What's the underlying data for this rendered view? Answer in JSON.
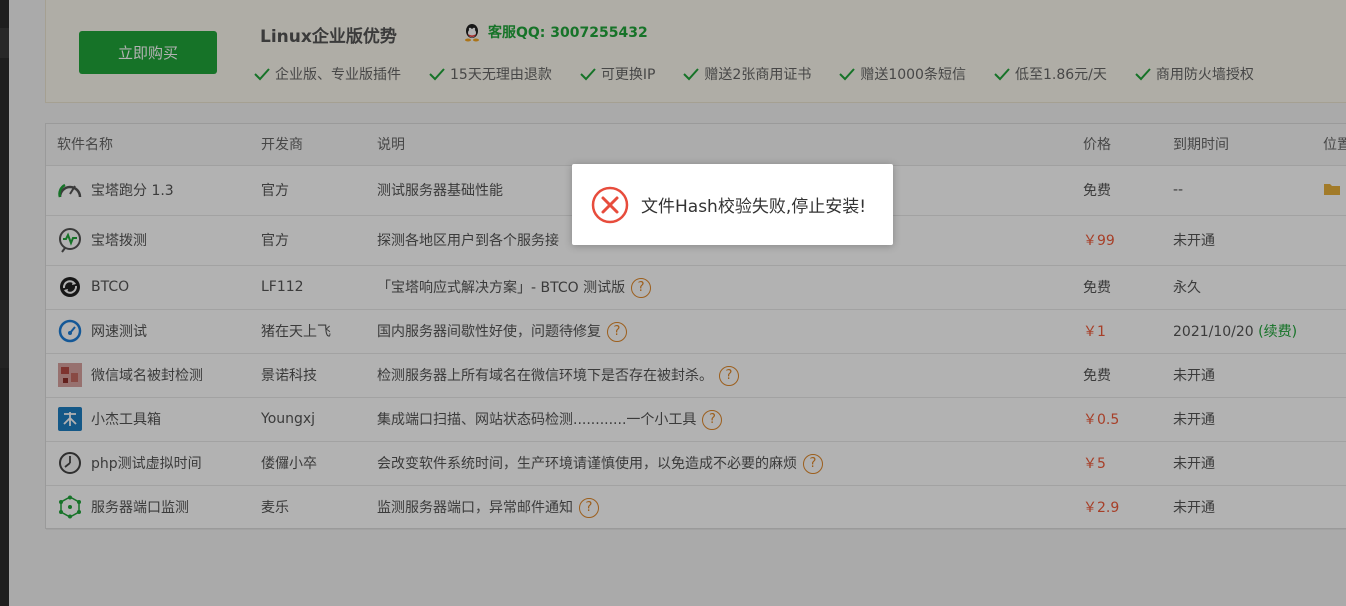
{
  "promo": {
    "buy_label": "立即购买",
    "title": "Linux企业版优势",
    "qq_text": "客服QQ: 3007255432",
    "features": [
      "企业版、专业版插件",
      "15天无理由退款",
      "可更换IP",
      "赠送2张商用证书",
      "赠送1000条短信",
      "低至1.86元/天",
      "商用防火墙授权"
    ]
  },
  "table": {
    "headers": {
      "name": "软件名称",
      "dev": "开发商",
      "desc": "说明",
      "price": "价格",
      "expire": "到期时间",
      "position": "位置"
    },
    "rows": [
      {
        "name": "宝塔跑分 1.3",
        "dev": "官方",
        "desc": "测试服务器基础性能",
        "price": "免费",
        "expire": "--",
        "icon": "speedometer-icon"
      },
      {
        "name": "宝塔拨测",
        "dev": "官方",
        "desc": "探测各地区用户到各个服务接",
        "price": "￥99",
        "expire": "未开通",
        "icon": "pulse-icon"
      },
      {
        "name": "BTCO",
        "dev": "LF112",
        "desc": "「宝塔响应式解决方案」- BTCO 测试版",
        "price": "免费",
        "expire": "永久",
        "icon": "sync-icon"
      },
      {
        "name": "网速测试",
        "dev": "猪在天上飞",
        "desc": "国内服务器间歇性好使，问题待修复",
        "price": "￥1",
        "expire": "2021/10/20",
        "renew": "(续费)",
        "icon": "gauge-icon"
      },
      {
        "name": "微信域名被封检测",
        "dev": "景诺科技",
        "desc": "检测服务器上所有域名在微信环境下是否存在被封杀。",
        "price": "免费",
        "expire": "未开通",
        "icon": "wechat-check-icon"
      },
      {
        "name": "小杰工具箱",
        "dev": "Youngxj",
        "desc": "集成端口扫描、网站状态码检测............一个小工具",
        "price": "￥0.5",
        "expire": "未开通",
        "icon": "toolbox-icon"
      },
      {
        "name": "php测试虚拟时间",
        "dev": "偻儸小卒",
        "desc": "会改变软件系统时间，生产环境请谨慎使用，以免造成不必要的麻烦",
        "price": "￥5",
        "expire": "未开通",
        "icon": "clock-icon"
      },
      {
        "name": "服务器端口监测",
        "dev": "麦乐",
        "desc": "监测服务器端口，异常邮件通知",
        "price": "￥2.9",
        "expire": "未开通",
        "icon": "network-icon"
      }
    ]
  },
  "dialog": {
    "message": "文件Hash校验失败,停止安装!",
    "icon": "error-icon"
  },
  "colors": {
    "accent": "#20a53a",
    "price_red": "#ef5b3a",
    "help_orange": "#e0882a"
  }
}
